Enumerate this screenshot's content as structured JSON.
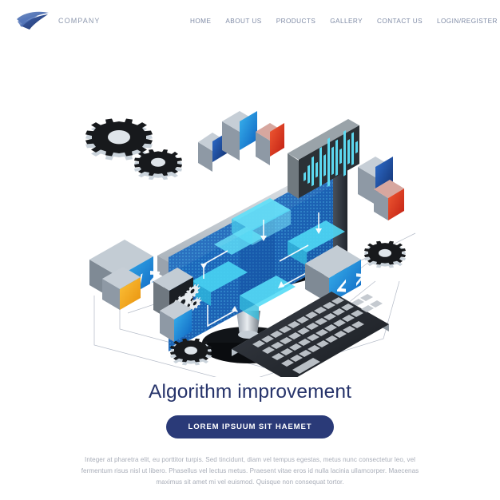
{
  "header": {
    "brand_name": "COMPANY",
    "logo_icon": "wing-bird-logo-icon",
    "nav": [
      {
        "label": "HOME",
        "name": "nav-home"
      },
      {
        "label": "ABOUT US",
        "name": "nav-about-us"
      },
      {
        "label": "PRODUCTS",
        "name": "nav-products"
      },
      {
        "label": "GALLERY",
        "name": "nav-gallery"
      },
      {
        "label": "CONTACT US",
        "name": "nav-contact-us"
      },
      {
        "label": "LOGIN/REGISTER",
        "name": "nav-login-register"
      }
    ]
  },
  "illustration": {
    "alt": "isometric desktop computer with algorithm flowchart, keyboard, gears and floating app cards",
    "icons": {
      "code_badge_left": "code-brackets-icon",
      "code_badge_right": "code-brackets-icon",
      "gear_badge": "gears-icon",
      "waveform_badge": "waveform-chart-icon",
      "gear_large": "gear-icon",
      "gear_small": "gear-icon",
      "gear_right": "gear-icon",
      "gear_bottom": "gear-icon"
    }
  },
  "content": {
    "headline": "Algorithm improvement",
    "cta_label": "LOREM IPSUUM SIT HAEMET",
    "paragraph": "Integer at pharetra elit, eu porttitor turpis. Sed tincidunt, diam vel tempus egestas, metus nunc consectetur leo, vel fermentum risus nisl ut libero. Phasellus vel lectus metus. Praesent vitae eros id nulla lacinia ullamcorper. Maecenas maximus sit amet mi vel euismod. Quisque non consequat tortor."
  },
  "colors": {
    "headline": "#27346b",
    "cta_bg": "#2a3a78",
    "nav_text": "#7f8ba6",
    "body_text": "#a8adb8",
    "accent_blue": "#1f8fe0",
    "accent_cyan": "#4fd8f5",
    "accent_red": "#d93a26",
    "accent_orange": "#f2a71b",
    "accent_navy": "#1b3f8f"
  }
}
